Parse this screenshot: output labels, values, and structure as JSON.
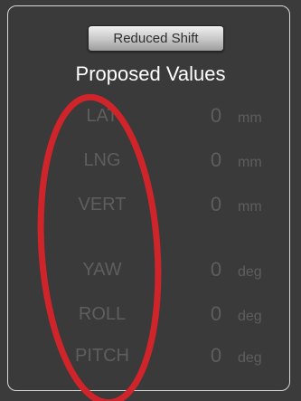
{
  "buttons": {
    "mode_label": "Reduced Shift"
  },
  "proposed": {
    "title": "Proposed Values",
    "rows": [
      {
        "label": "LAT",
        "value": "0",
        "unit": "mm"
      },
      {
        "label": "LNG",
        "value": "0",
        "unit": "mm"
      },
      {
        "label": "VERT",
        "value": "0",
        "unit": "mm"
      },
      {
        "label": "YAW",
        "value": "0",
        "unit": "deg"
      },
      {
        "label": "ROLL",
        "value": "0",
        "unit": "deg"
      },
      {
        "label": "PITCH",
        "value": "0",
        "unit": "deg"
      }
    ]
  },
  "colors": {
    "background": "#3b3b3b",
    "panel_border": "#d8d8d8",
    "title_text": "#ffffff",
    "row_text": "#5e5e5e",
    "annotation_red": "#d0242b"
  }
}
